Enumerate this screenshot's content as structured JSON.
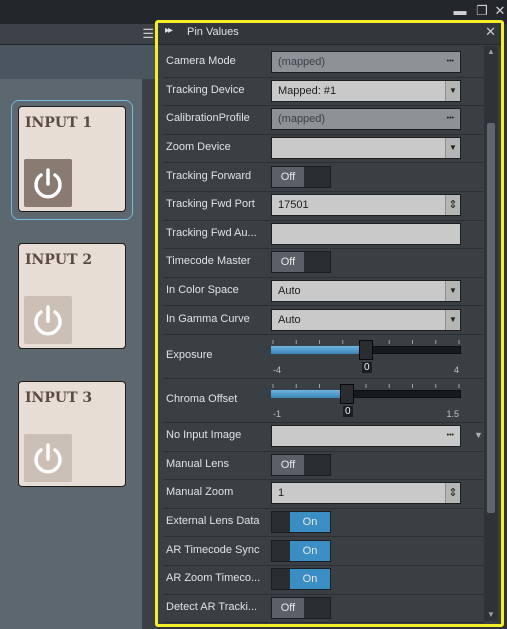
{
  "window_controls": {
    "minimize": "▬",
    "restore": "❐",
    "close": "✕"
  },
  "inputs": [
    {
      "label": "INPUT 1"
    },
    {
      "label": "INPUT 2"
    },
    {
      "label": "INPUT 3"
    }
  ],
  "panel": {
    "title": "Pin Values",
    "header_arrows": "▸▸",
    "close": "✕",
    "rows": [
      {
        "label": "Camera Mode",
        "kind": "field",
        "value": "(mapped)",
        "disabled": true,
        "end": "dots"
      },
      {
        "label": "Tracking Device",
        "kind": "field",
        "value": "Mapped: #1",
        "end": "dropdown"
      },
      {
        "label": "CalibrationProfile",
        "kind": "field",
        "value": "(mapped)",
        "disabled": true,
        "end": "dots"
      },
      {
        "label": "Zoom Device",
        "kind": "field",
        "value": "",
        "end": "dropdown"
      },
      {
        "label": "Tracking Forward",
        "kind": "toggle",
        "value": "Off"
      },
      {
        "label": "Tracking Fwd Port",
        "kind": "field",
        "value": "17501",
        "end": "spin"
      },
      {
        "label": "Tracking Fwd Au...",
        "kind": "field",
        "value": "",
        "end": "none"
      },
      {
        "label": "Timecode Master",
        "kind": "toggle",
        "value": "Off"
      },
      {
        "label": "In Color Space",
        "kind": "field",
        "value": "Auto",
        "end": "dropdown"
      },
      {
        "label": "In Gamma Curve",
        "kind": "field",
        "value": "Auto",
        "end": "dropdown"
      },
      {
        "label": "Exposure",
        "kind": "slider",
        "min": "-4",
        "max": "4",
        "value": "0",
        "fraction": 0.5
      },
      {
        "label": "Chroma Offset",
        "kind": "slider",
        "min": "-1",
        "max": "1.5",
        "value": "0",
        "fraction": 0.4
      },
      {
        "label": "No Input Image",
        "kind": "field",
        "value": "",
        "end": "dots",
        "side_arrow": true
      },
      {
        "label": "Manual Lens",
        "kind": "toggle",
        "value": "Off"
      },
      {
        "label": "Manual Zoom",
        "kind": "field",
        "value": "1",
        "end": "spin"
      },
      {
        "label": "External Lens Data",
        "kind": "toggle",
        "value": "On"
      },
      {
        "label": "AR Timecode Sync",
        "kind": "toggle",
        "value": "On"
      },
      {
        "label": "AR Zoom Timeco...",
        "kind": "toggle",
        "value": "On"
      },
      {
        "label": "Detect AR Tracki...",
        "kind": "toggle",
        "value": "Off"
      }
    ]
  },
  "colors": {
    "highlight": "#f5ee2a",
    "toggle_on": "#3a8ec4",
    "selection": "#7ab8d8"
  }
}
